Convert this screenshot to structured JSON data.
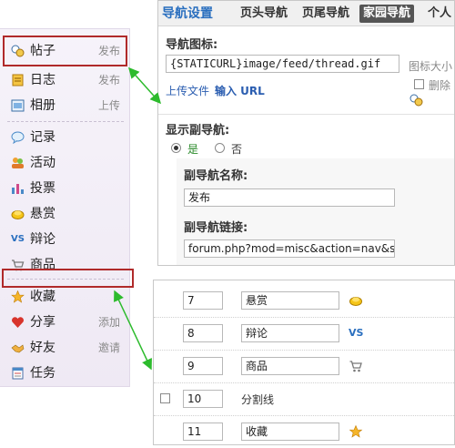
{
  "left_nav": {
    "items": [
      {
        "id": "tiezi",
        "label": "帖子",
        "action": "发布",
        "icon": "thread-icon"
      },
      {
        "id": "rizhi",
        "label": "日志",
        "action": "发布",
        "icon": "blog-icon"
      },
      {
        "id": "xiangce",
        "label": "相册",
        "action": "上传",
        "icon": "album-icon"
      },
      {
        "id": "jilu",
        "label": "记录",
        "action": "",
        "icon": "chat-bubble-icon"
      },
      {
        "id": "huodong",
        "label": "活动",
        "action": "",
        "icon": "people-icon"
      },
      {
        "id": "toupiao",
        "label": "投票",
        "action": "",
        "icon": "bar-chart-icon"
      },
      {
        "id": "xuanshang",
        "label": "悬赏",
        "action": "",
        "icon": "gold-icon"
      },
      {
        "id": "bianlun",
        "label": "辩论",
        "action": "",
        "icon": "vs-icon"
      },
      {
        "id": "shangpin",
        "label": "商品",
        "action": "",
        "icon": "cart-icon"
      },
      {
        "id": "shoucang",
        "label": "收藏",
        "action": "",
        "icon": "star-icon"
      },
      {
        "id": "fenxiang",
        "label": "分享",
        "action": "添加",
        "icon": "heart-icon"
      },
      {
        "id": "haoyou",
        "label": "好友",
        "action": "邀请",
        "icon": "handshake-icon"
      },
      {
        "id": "renwu",
        "label": "任务",
        "action": "",
        "icon": "task-icon"
      }
    ],
    "vs_text": "VS"
  },
  "nav_panel": {
    "title": "导航设置",
    "tabs": [
      "页头导航",
      "页尾导航",
      "家园导航",
      "个人"
    ],
    "active_tab": "家园导航",
    "icon_label": "导航图标:",
    "icon_value": "{STATICURL}image/feed/thread.gif",
    "icon_size_hint": "图标大小",
    "upload_link": "上传文件",
    "input_url_link": "输入 URL",
    "delete_label": "删除",
    "show_subnav_label": "显示副导航:",
    "radio_yes": "是",
    "radio_no": "否",
    "subnav_name_label": "副导航名称:",
    "subnav_name_value": "发布",
    "subnav_link_label": "副导航链接:",
    "subnav_link_value": "forum.php?mod=misc&action=nav&s"
  },
  "list_panel": {
    "rows": [
      {
        "order": "7",
        "name": "悬赏",
        "icon": "gold-icon",
        "separator": false
      },
      {
        "order": "8",
        "name": "辩论",
        "icon": "vs-icon",
        "separator": false
      },
      {
        "order": "9",
        "name": "商品",
        "icon": "cart-icon",
        "separator": false
      },
      {
        "order": "10",
        "name": "分割线",
        "icon": "",
        "separator": true
      },
      {
        "order": "11",
        "name": "收藏",
        "icon": "star-icon",
        "separator": false
      }
    ]
  },
  "colors": {
    "annotation_red": "#b02a2a",
    "arrow_green": "#2dbb2d",
    "link_blue": "#2a5db0",
    "title_blue": "#2a6fbf"
  }
}
